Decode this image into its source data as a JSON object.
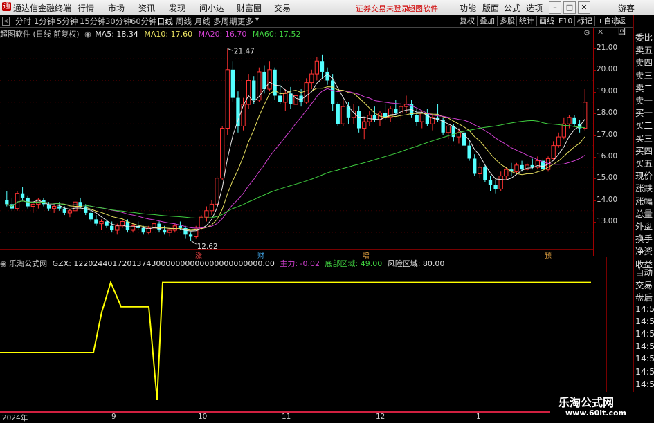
{
  "menubar": {
    "app_title": "通达信金融终端",
    "menus": [
      "行情",
      "市场",
      "资讯",
      "发现",
      "问小达",
      "财富圈",
      "交易"
    ],
    "warning": "证券交易未登录",
    "brand": "超图软件",
    "right_menus": [
      "功能",
      "版面",
      "公式",
      "选项"
    ],
    "guest": "游客"
  },
  "periodbar": {
    "tabs": [
      "分时",
      "1分钟",
      "5分钟",
      "15分钟",
      "30分钟",
      "60分钟",
      "日线",
      "周线",
      "月线",
      "多周期",
      "更多"
    ],
    "active": "日线",
    "right_buttons": [
      "复权",
      "叠加",
      "多股",
      "统计",
      "画线",
      "F10",
      "标记",
      "+自选",
      "返回"
    ]
  },
  "chart_info": {
    "title": "超图软件 (日线 前复权)",
    "ma5": "MA5: 18.34",
    "ma10": "MA10: 17.60",
    "ma20": "MA20: 16.70",
    "ma60": "MA60: 17.52",
    "high_mark": "21.47",
    "low_mark": "12.62",
    "event_markers": [
      "涨",
      "财",
      "增",
      "预"
    ]
  },
  "indicator_info": {
    "name": "乐淘公式网",
    "gzx": "GZX: 122024401720137430000000000000000000000.00",
    "zhuli": "主力: -0.02",
    "dibu": "底部区域: 49.00",
    "fengxian": "风险区域: 80.00"
  },
  "right_panel": {
    "labels": [
      "委比",
      "卖五",
      "卖四",
      "卖三",
      "卖二",
      "卖一",
      "买一",
      "买二",
      "买三",
      "买四",
      "买五",
      "现价",
      "涨跌",
      "涨幅",
      "总量",
      "外盘",
      "换手",
      "净资",
      "收益"
    ],
    "lower_labels": [
      "自动",
      "交易",
      "盘后",
      "14:5",
      "14:5",
      "14:5",
      "14:5",
      "14:5",
      "14:5",
      "14:5"
    ]
  },
  "bottom_axis": [
    "2024年",
    "9",
    "10",
    "11",
    "12",
    "1"
  ],
  "watermark": {
    "title": "乐淘公式网",
    "url": "www.60lt.com"
  },
  "chart_data": {
    "type": "candlestick",
    "ylim": [
      12.4,
      21.8
    ],
    "yticks": [
      13.0,
      14.0,
      15.0,
      16.0,
      17.0,
      18.0,
      19.0,
      20.0,
      21.0
    ],
    "ohlc": [
      [
        14.5,
        14.9,
        14.2,
        14.3
      ],
      [
        14.3,
        14.6,
        14.0,
        14.1
      ],
      [
        14.1,
        14.9,
        14.0,
        14.8
      ],
      [
        14.8,
        15.1,
        14.5,
        14.6
      ],
      [
        14.6,
        14.7,
        14.1,
        14.2
      ],
      [
        14.2,
        14.4,
        13.9,
        14.3
      ],
      [
        14.3,
        14.6,
        14.1,
        14.5
      ],
      [
        14.5,
        14.6,
        14.2,
        14.3
      ],
      [
        14.3,
        14.4,
        14.0,
        14.1
      ],
      [
        14.1,
        14.3,
        13.9,
        14.2
      ],
      [
        14.2,
        14.4,
        14.0,
        14.1
      ],
      [
        14.1,
        14.2,
        13.8,
        13.9
      ],
      [
        13.9,
        14.1,
        13.7,
        14.0
      ],
      [
        14.0,
        14.5,
        13.9,
        14.4
      ],
      [
        14.4,
        14.6,
        14.1,
        14.2
      ],
      [
        14.2,
        14.3,
        13.8,
        13.9
      ],
      [
        13.9,
        14.0,
        13.5,
        13.6
      ],
      [
        13.6,
        13.8,
        13.3,
        13.4
      ],
      [
        13.4,
        13.6,
        13.1,
        13.5
      ],
      [
        13.5,
        13.6,
        13.2,
        13.3
      ],
      [
        13.3,
        13.5,
        13.0,
        13.1
      ],
      [
        13.1,
        13.4,
        12.9,
        13.3
      ],
      [
        13.3,
        13.6,
        13.2,
        13.5
      ],
      [
        13.5,
        13.6,
        13.0,
        13.1
      ],
      [
        13.1,
        13.4,
        13.0,
        13.3
      ],
      [
        13.3,
        13.5,
        13.1,
        13.2
      ],
      [
        13.2,
        13.3,
        12.9,
        13.0
      ],
      [
        13.0,
        13.3,
        12.9,
        13.2
      ],
      [
        13.2,
        13.5,
        13.1,
        13.4
      ],
      [
        13.4,
        13.5,
        13.0,
        13.1
      ],
      [
        13.1,
        13.3,
        12.9,
        13.0
      ],
      [
        13.0,
        13.2,
        12.8,
        13.1
      ],
      [
        13.1,
        13.4,
        13.0,
        13.3
      ],
      [
        13.3,
        13.5,
        13.1,
        13.2
      ],
      [
        13.2,
        13.3,
        12.7,
        12.9
      ],
      [
        12.9,
        13.0,
        12.62,
        12.8
      ],
      [
        12.8,
        13.3,
        12.7,
        13.2
      ],
      [
        13.2,
        13.8,
        13.1,
        13.7
      ],
      [
        13.7,
        14.2,
        13.5,
        14.0
      ],
      [
        14.0,
        14.5,
        13.8,
        14.3
      ],
      [
        14.3,
        15.6,
        14.2,
        15.5
      ],
      [
        15.5,
        17.9,
        15.4,
        17.8
      ],
      [
        17.8,
        21.47,
        17.5,
        20.5
      ],
      [
        20.5,
        20.9,
        19.0,
        19.2
      ],
      [
        19.2,
        19.5,
        17.6,
        17.9
      ],
      [
        17.9,
        19.2,
        17.7,
        18.9
      ],
      [
        18.9,
        20.3,
        18.7,
        20.0
      ],
      [
        20.0,
        20.2,
        18.9,
        19.1
      ],
      [
        19.1,
        20.6,
        19.0,
        20.4
      ],
      [
        20.4,
        20.7,
        19.4,
        19.6
      ],
      [
        19.6,
        20.9,
        19.5,
        20.5
      ],
      [
        20.5,
        20.6,
        19.1,
        19.3
      ],
      [
        19.3,
        19.8,
        18.9,
        19.0
      ],
      [
        19.0,
        19.6,
        18.6,
        19.4
      ],
      [
        19.4,
        19.7,
        18.7,
        18.9
      ],
      [
        18.9,
        19.5,
        18.8,
        19.3
      ],
      [
        19.3,
        19.6,
        18.8,
        19.0
      ],
      [
        19.0,
        20.1,
        18.9,
        19.9
      ],
      [
        19.9,
        20.5,
        19.6,
        20.3
      ],
      [
        20.3,
        21.1,
        20.0,
        20.9
      ],
      [
        20.9,
        21.2,
        20.1,
        20.4
      ],
      [
        20.4,
        20.6,
        19.8,
        20.0
      ],
      [
        20.0,
        20.3,
        18.6,
        18.9
      ],
      [
        18.9,
        19.0,
        17.9,
        18.0
      ],
      [
        18.0,
        19.1,
        17.9,
        18.8
      ],
      [
        18.8,
        19.0,
        18.0,
        18.3
      ],
      [
        18.3,
        18.9,
        18.0,
        18.6
      ],
      [
        18.6,
        18.8,
        17.6,
        17.8
      ],
      [
        17.8,
        18.3,
        17.3,
        18.1
      ],
      [
        18.1,
        18.6,
        17.9,
        18.4
      ],
      [
        18.4,
        18.8,
        18.1,
        18.2
      ],
      [
        18.2,
        18.6,
        17.9,
        18.5
      ],
      [
        18.5,
        18.9,
        18.2,
        18.3
      ],
      [
        18.3,
        18.8,
        18.1,
        18.7
      ],
      [
        18.7,
        19.1,
        18.4,
        18.5
      ],
      [
        18.5,
        18.9,
        18.2,
        18.8
      ],
      [
        18.8,
        19.3,
        18.5,
        18.9
      ],
      [
        18.9,
        19.1,
        18.3,
        18.4
      ],
      [
        18.4,
        18.7,
        17.9,
        18.1
      ],
      [
        18.1,
        18.6,
        17.8,
        18.5
      ],
      [
        18.5,
        18.7,
        17.9,
        18.0
      ],
      [
        18.0,
        18.4,
        17.7,
        18.3
      ],
      [
        18.3,
        18.9,
        18.1,
        18.2
      ],
      [
        18.2,
        18.3,
        17.5,
        17.6
      ],
      [
        17.6,
        18.0,
        17.3,
        17.9
      ],
      [
        17.9,
        18.0,
        17.2,
        17.4
      ],
      [
        17.4,
        17.8,
        17.1,
        17.6
      ],
      [
        17.6,
        17.7,
        16.8,
        17.0
      ],
      [
        17.0,
        17.2,
        16.3,
        16.4
      ],
      [
        16.4,
        16.6,
        15.6,
        15.7
      ],
      [
        15.7,
        16.2,
        15.5,
        16.0
      ],
      [
        16.0,
        16.1,
        15.3,
        15.4
      ],
      [
        15.4,
        15.6,
        14.9,
        15.2
      ],
      [
        15.2,
        15.4,
        14.8,
        15.0
      ],
      [
        15.0,
        15.8,
        14.9,
        15.6
      ],
      [
        15.6,
        16.0,
        15.4,
        15.9
      ],
      [
        15.9,
        16.2,
        15.6,
        15.8
      ],
      [
        15.8,
        16.2,
        15.7,
        16.1
      ],
      [
        16.1,
        16.3,
        15.8,
        15.9
      ],
      [
        15.9,
        16.2,
        15.8,
        16.1
      ],
      [
        16.1,
        16.4,
        15.9,
        16.0
      ],
      [
        16.0,
        16.5,
        15.9,
        16.3
      ],
      [
        16.3,
        16.4,
        15.8,
        15.9
      ],
      [
        15.9,
        16.5,
        15.8,
        16.4
      ],
      [
        16.4,
        17.2,
        16.3,
        17.0
      ],
      [
        17.0,
        17.6,
        16.9,
        17.4
      ],
      [
        17.4,
        18.3,
        17.3,
        18.0
      ],
      [
        18.0,
        18.4,
        17.8,
        18.3
      ],
      [
        18.3,
        18.4,
        17.9,
        18.0
      ],
      [
        18.0,
        18.2,
        17.6,
        17.8
      ],
      [
        17.8,
        19.6,
        17.7,
        19.0
      ]
    ],
    "indicator": {
      "ylim": [
        0,
        100
      ],
      "dibu": 49,
      "fengxian": 80
    }
  }
}
